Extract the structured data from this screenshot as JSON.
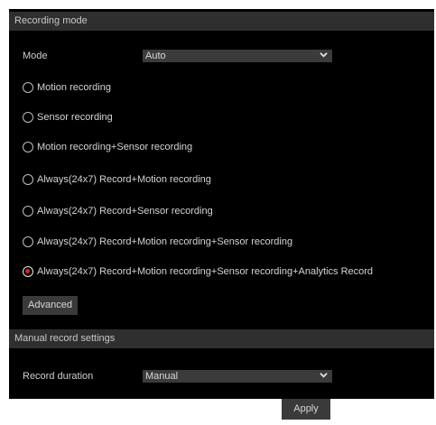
{
  "recording_mode": {
    "header": "Recording mode",
    "mode_label": "Mode",
    "mode_value": "Auto",
    "options": [
      {
        "label": "Motion recording",
        "selected": false
      },
      {
        "label": "Sensor recording",
        "selected": false
      },
      {
        "label": "Motion recording+Sensor recording",
        "selected": false
      },
      {
        "label": "Always(24x7) Record+Motion recording",
        "selected": false
      },
      {
        "label": "Always(24x7) Record+Sensor recording",
        "selected": false
      },
      {
        "label": "Always(24x7) Record+Motion recording+Sensor recording",
        "selected": false
      },
      {
        "label": "Always(24x7) Record+Motion recording+Sensor recording+Analytics Record",
        "selected": true
      }
    ],
    "advanced_label": "Advanced"
  },
  "manual_record": {
    "header": "Manual record settings",
    "duration_label": "Record duration",
    "duration_value": "Manual",
    "apply_label": "Apply"
  },
  "colors": {
    "panel_bg": "#000000",
    "header_bg": "#2f2f2f",
    "control_bg": "#3b3b3b",
    "radio_selected": "#e02020"
  },
  "icons": {
    "dropdown": "chevron-down-icon"
  }
}
